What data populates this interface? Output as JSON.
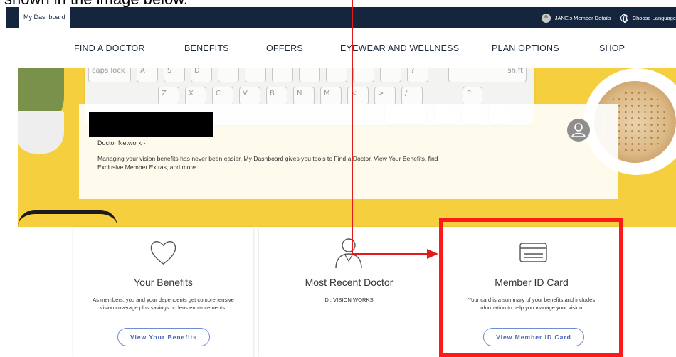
{
  "caption": "shown in the image below.",
  "header": {
    "dashboard_tab": "My Dashboard",
    "member_details": "JANE's Member Details",
    "choose_language": "Choose Language"
  },
  "nav": [
    "FIND A DOCTOR",
    "BENEFITS",
    "OFFERS",
    "EYEWEAR AND WELLNESS",
    "PLAN OPTIONS",
    "SHOP"
  ],
  "hero": {
    "doctor_network": "Doctor Network -",
    "intro": "Managing your vision benefits has never been easier. My Dashboard gives you tools to Find a Doctor, View Your Benefits, find Exclusive Member Extras, and more."
  },
  "tiles": [
    {
      "title": "Your Benefits",
      "desc": "As members, you and your dependents get comprehensive vision coverage plus savings on lens enhancements.",
      "button": "View Your Benefits"
    },
    {
      "title": "Most Recent Doctor",
      "desc": "Dr. VISION WORKS"
    },
    {
      "title": "Member ID Card",
      "desc": "Your card is a summary of your benefits and includes information to help you manage your vision.",
      "button": "View Member ID Card"
    }
  ],
  "annotation": {
    "highlight_color": "#ff1a1a",
    "arrow_color": "#e31a1a"
  }
}
